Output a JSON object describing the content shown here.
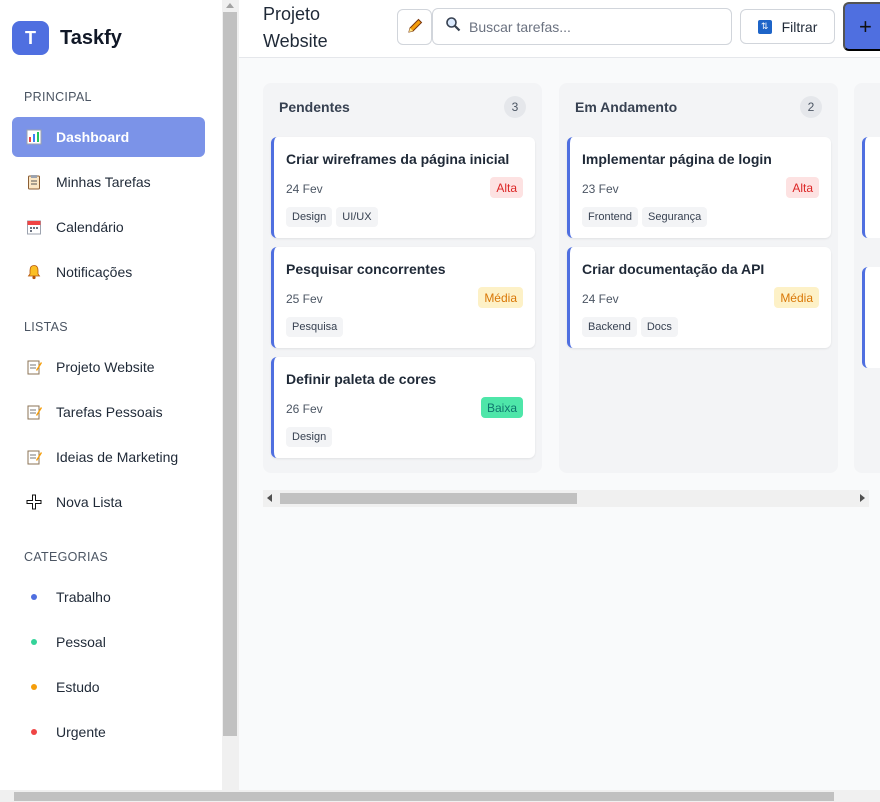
{
  "brand": {
    "logo_letter": "T",
    "name": "Taskfy"
  },
  "sidebar": {
    "sections": {
      "principal": "PRINCIPAL",
      "listas": "LISTAS",
      "categorias": "CATEGORIAS"
    },
    "principal_items": [
      {
        "label": "Dashboard",
        "icon": "chart-icon",
        "active": true
      },
      {
        "label": "Minhas Tarefas",
        "icon": "clipboard-icon"
      },
      {
        "label": "Calendário",
        "icon": "calendar-icon"
      },
      {
        "label": "Notificações",
        "icon": "bell-icon"
      }
    ],
    "list_items": [
      {
        "label": "Projeto Website",
        "icon": "memo-icon"
      },
      {
        "label": "Tarefas Pessoais",
        "icon": "memo-icon"
      },
      {
        "label": "Ideias de Marketing",
        "icon": "memo-icon"
      },
      {
        "label": "Nova Lista",
        "icon": "plus-icon"
      }
    ],
    "category_items": [
      {
        "label": "Trabalho",
        "color": "#4f6fe0"
      },
      {
        "label": "Pessoal",
        "color": "#34d399"
      },
      {
        "label": "Estudo",
        "color": "#f59e0b"
      },
      {
        "label": "Urgente",
        "color": "#ef4444"
      }
    ]
  },
  "header": {
    "title": "Projeto Website",
    "search_placeholder": "Buscar tarefas...",
    "filter_label": "Filtrar",
    "add_icon": "plus-icon"
  },
  "board": {
    "columns": [
      {
        "title": "Pendentes",
        "count": "3",
        "cards": [
          {
            "title": "Criar wireframes da página inicial",
            "date": "24 Fev",
            "priority": "Alta",
            "tags": [
              "Design",
              "UI/UX"
            ]
          },
          {
            "title": "Pesquisar concorrentes",
            "date": "25 Fev",
            "priority": "Média",
            "tags": [
              "Pesquisa"
            ]
          },
          {
            "title": "Definir paleta de cores",
            "date": "26 Fev",
            "priority": "Baixa",
            "tags": [
              "Design"
            ]
          }
        ]
      },
      {
        "title": "Em Andamento",
        "count": "2",
        "cards": [
          {
            "title": "Implementar página de login",
            "date": "23 Fev",
            "priority": "Alta",
            "tags": [
              "Frontend",
              "Segurança"
            ]
          },
          {
            "title": "Criar documentação da API",
            "date": "24 Fev",
            "priority": "Média",
            "tags": [
              "Backend",
              "Docs"
            ]
          }
        ]
      }
    ]
  },
  "colors": {
    "accent": "#4f6fe0",
    "active_nav": "#7b93e8"
  }
}
